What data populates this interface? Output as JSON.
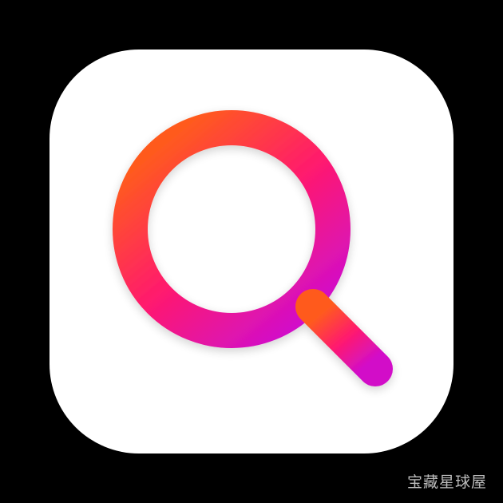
{
  "icon": {
    "name": "search-icon",
    "gradient": {
      "start": "#ff5a1f",
      "mid": "#ff1a6e",
      "end": "#d20fc8"
    },
    "tile_color": "#ffffff",
    "background_color": "#000000"
  },
  "watermark": {
    "text": "宝藏星球屋"
  }
}
